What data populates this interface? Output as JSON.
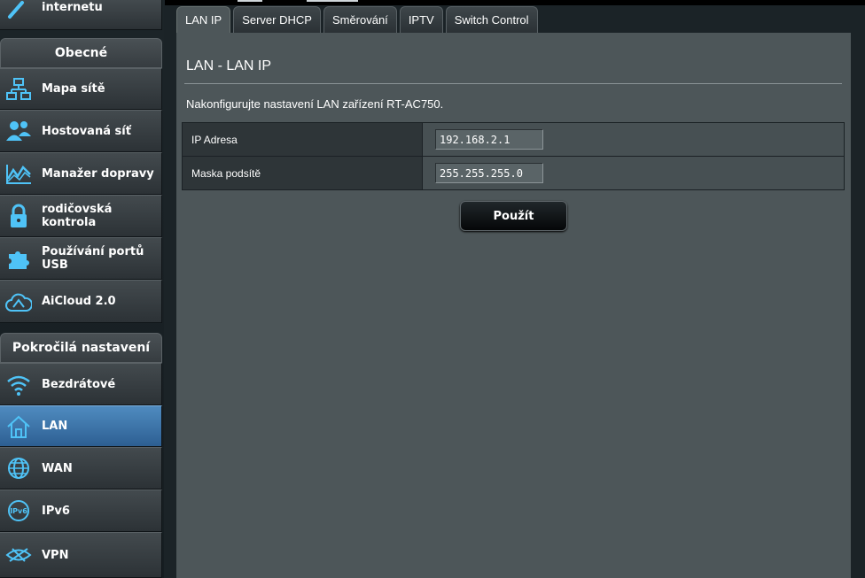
{
  "sidebar": {
    "top_item_label": "internetu",
    "general_section": {
      "title": "Obecné",
      "items": [
        {
          "label": "Mapa sítě",
          "icon": "network-map-icon"
        },
        {
          "label": "Hostovaná síť",
          "icon": "guest-network-icon"
        },
        {
          "label": "Manažer dopravy",
          "icon": "traffic-manager-icon"
        },
        {
          "label": "rodičovská kontrola",
          "icon": "lock-icon"
        },
        {
          "label": "Používání portů USB",
          "icon": "puzzle-icon"
        },
        {
          "label": "AiCloud 2.0",
          "icon": "cloud-icon"
        }
      ]
    },
    "advanced_section": {
      "title": "Pokročilá nastavení",
      "items": [
        {
          "label": "Bezdrátové",
          "icon": "wifi-icon"
        },
        {
          "label": "LAN",
          "icon": "home-icon",
          "selected": true
        },
        {
          "label": "WAN",
          "icon": "globe-icon"
        },
        {
          "label": "IPv6",
          "icon": "ipv6-globe-icon"
        },
        {
          "label": "VPN",
          "icon": "vpn-icon"
        }
      ]
    }
  },
  "tabs": [
    {
      "label": "LAN IP",
      "active": true
    },
    {
      "label": "Server DHCP"
    },
    {
      "label": "Směrování"
    },
    {
      "label": "IPTV"
    },
    {
      "label": "Switch Control"
    }
  ],
  "main": {
    "title": "LAN - LAN IP",
    "description": "Nakonfigurujte nastavení LAN zařízení RT-AC750.",
    "fields": [
      {
        "label": "IP Adresa",
        "value": "192.168.2.1"
      },
      {
        "label": "Maska podsítě",
        "value": "255.255.255.0"
      }
    ],
    "apply_label": "Použít"
  },
  "colors": {
    "accent_blue": "#4fc3f7",
    "selected_item": "#3f74a8",
    "panel_bg": "#4d5659"
  }
}
